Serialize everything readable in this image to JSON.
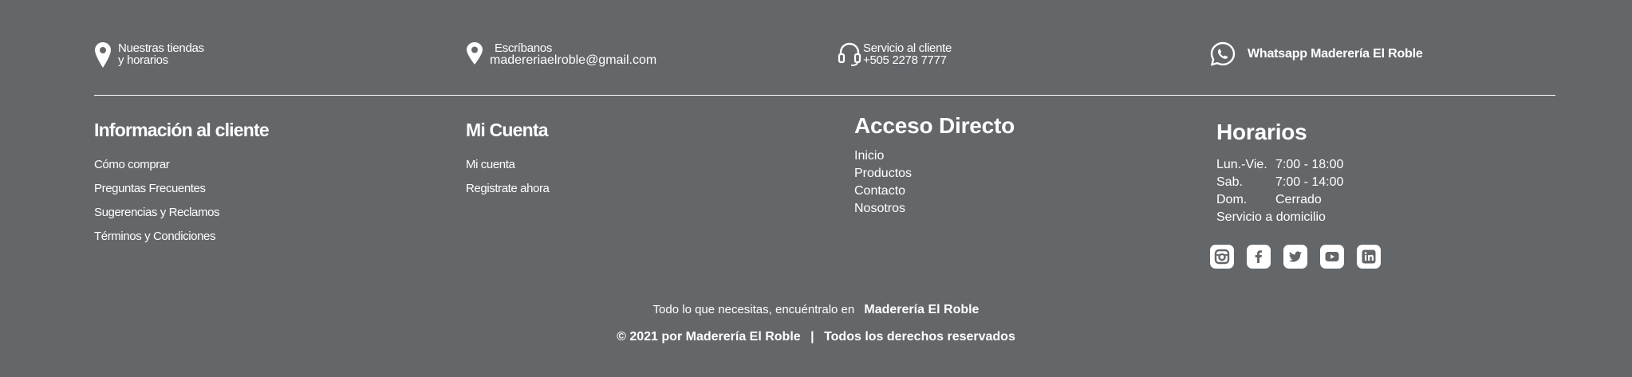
{
  "contacts": {
    "stores": {
      "line1": "Nuestras tiendas",
      "line2": "y horarios",
      "icon": "map-pin-icon"
    },
    "write": {
      "line1": "Escríbanos",
      "line2": "madereriaelroble@gmail.com",
      "icon": "map-pin-icon"
    },
    "service": {
      "line1": "Servicio al cliente",
      "line2": "+505 2278 7777",
      "icon": "headset-icon"
    },
    "whatsapp": {
      "label": "Whatsapp Maderería El Roble",
      "icon": "whatsapp-icon"
    }
  },
  "columns": {
    "info": {
      "title": "Información al cliente",
      "links": [
        "Cómo comprar",
        "Preguntas Frecuentes",
        "Sugerencias y Reclamos",
        "Términos y Condiciones"
      ]
    },
    "account": {
      "title": "Mi Cuenta",
      "links": [
        "Mi cuenta",
        "Registrate ahora"
      ]
    },
    "direct": {
      "title": "Acceso Directo",
      "links": [
        "Inicio",
        "Productos",
        "Contacto",
        "Nosotros"
      ]
    },
    "hours": {
      "title": "Horarios",
      "rows": [
        {
          "day": "Lun.-Vie.",
          "time": "7:00 - 18:00"
        },
        {
          "day": "Sab.",
          "time": "7:00 - 14:00"
        },
        {
          "day": "Dom.",
          "time": "Cerrado"
        }
      ],
      "delivery": "Servicio a domicilio",
      "social": [
        "instagram-icon",
        "facebook-icon",
        "twitter-icon",
        "youtube-icon",
        "linkedin-icon"
      ]
    }
  },
  "footer": {
    "tagline": "Todo lo que necesitas, encuéntralo en",
    "brand": "Maderería El Roble",
    "copyright": "© 2021 por Maderería El Roble",
    "separator": "|",
    "rights": "Todos los derechos reservados"
  },
  "colors": {
    "background": "#63676a",
    "text": "#ffffff"
  }
}
